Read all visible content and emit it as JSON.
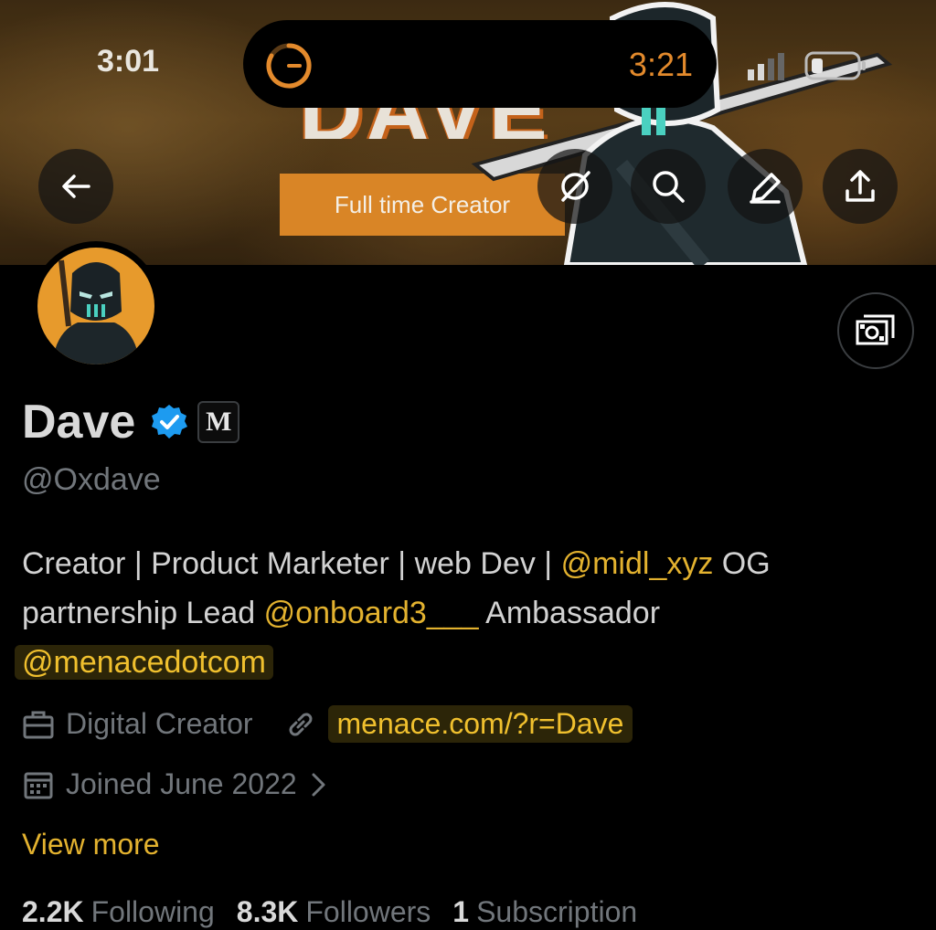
{
  "status_bar": {
    "time": "3:01",
    "timer": "3:21"
  },
  "banner": {
    "title": "DAVE",
    "tagline": "Full time Creator"
  },
  "header_actions": {
    "back": "back-arrow-icon",
    "grok": "grok-icon",
    "search": "search-icon",
    "edit": "edit-icon",
    "share": "share-icon"
  },
  "profile": {
    "display_name": "Dave",
    "affiliate_badge": "M",
    "handle": "@Oxdave",
    "bio": {
      "line1_text": "Creator | Product Marketer | web Dev | ",
      "mention1": "@midl_xyz",
      "line1_tail": " OG",
      "line2_text": "partnership Lead ",
      "mention2": "@onboard3___",
      "line2_tail": " Ambassador",
      "mention3": "@menacedotcom"
    },
    "category": "Digital Creator",
    "website": "menace.com/?r=Dave",
    "joined": "Joined June 2022",
    "view_more": "View more"
  },
  "stats": {
    "following_count": "2.2K",
    "following_label": "Following",
    "followers_count": "8.3K",
    "followers_label": "Followers",
    "subscriptions_count": "1",
    "subscriptions_label": "Subscription"
  },
  "colors": {
    "accent": "#e3b22f",
    "verified": "#1d9bf0",
    "banner_orange": "#d98526"
  }
}
